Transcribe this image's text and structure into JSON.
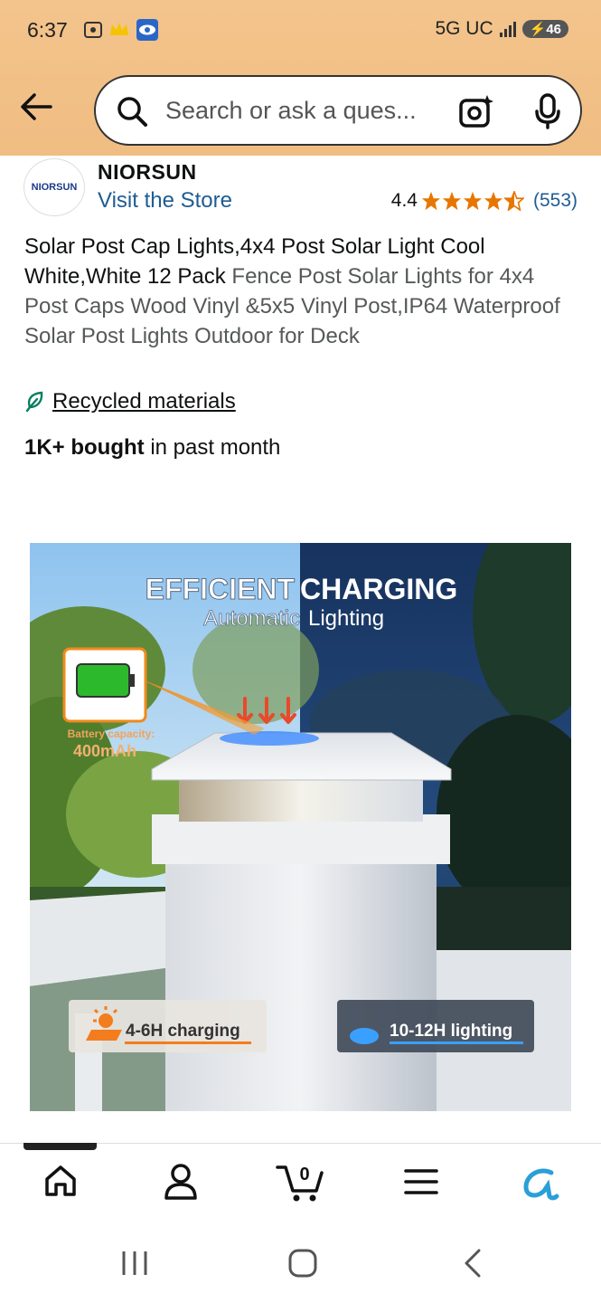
{
  "status": {
    "time": "6:37",
    "network": "5G UC",
    "battery": "46"
  },
  "search": {
    "placeholder": "Search or ask a ques..."
  },
  "brand": {
    "logo_text": "NIORSUN",
    "name": "NIORSUN",
    "visit_store": "Visit the Store"
  },
  "rating": {
    "value": "4.4",
    "count": "(553)",
    "stars": 4.4
  },
  "product": {
    "title": "Solar Post Cap Lights,4x4 Post Solar Light Cool White,White 12 Pack",
    "subtitle": "Fence Post Solar Lights for 4x4 Post Caps Wood Vinyl &5x5 Vinyl Post,IP64 Waterproof Solar Post Lights Outdoor for Deck",
    "recycled": "Recycled materials",
    "bought_bold": "1K+ bought",
    "bought_rest": " in past month"
  },
  "image": {
    "headline_left": "EFFICIENT",
    "headline_right": "CHARGING",
    "sub_left": "Automatic",
    "sub_right": "Lighting",
    "battery_label": "Battery capacity:",
    "battery_value": "400mAh",
    "charging_badge": "4-6H charging",
    "lighting_badge": "10-12H lighting"
  },
  "nav": {
    "cart_count": "0"
  },
  "colors": {
    "header": "#f0bd82",
    "link": "#1f5c92",
    "star": "#e77600",
    "accent": "#f37d1e"
  }
}
